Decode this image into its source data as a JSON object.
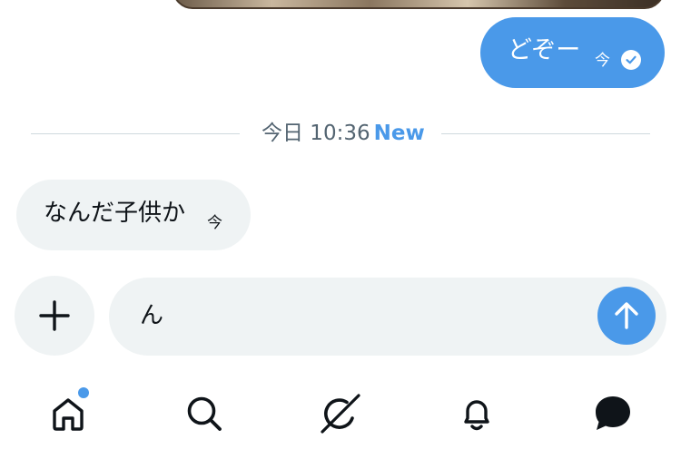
{
  "conversation": {
    "outgoing_message": {
      "text": "どぞー",
      "time": "今"
    },
    "divider": {
      "label": "今日 10:36",
      "new_label": "New"
    },
    "incoming_message": {
      "text": "なんだ子供か",
      "time": "今"
    }
  },
  "composer": {
    "value": "ん"
  },
  "tabbar": {
    "items": [
      {
        "icon": "home-icon",
        "has_badge": true
      },
      {
        "icon": "search-icon"
      },
      {
        "icon": "grok-icon"
      },
      {
        "icon": "bell-icon"
      },
      {
        "icon": "messages-icon"
      }
    ]
  },
  "colors": {
    "accent": "#4a99e9",
    "bubble_in": "#eff3f4",
    "text": "#0f1419",
    "muted": "#536471"
  }
}
